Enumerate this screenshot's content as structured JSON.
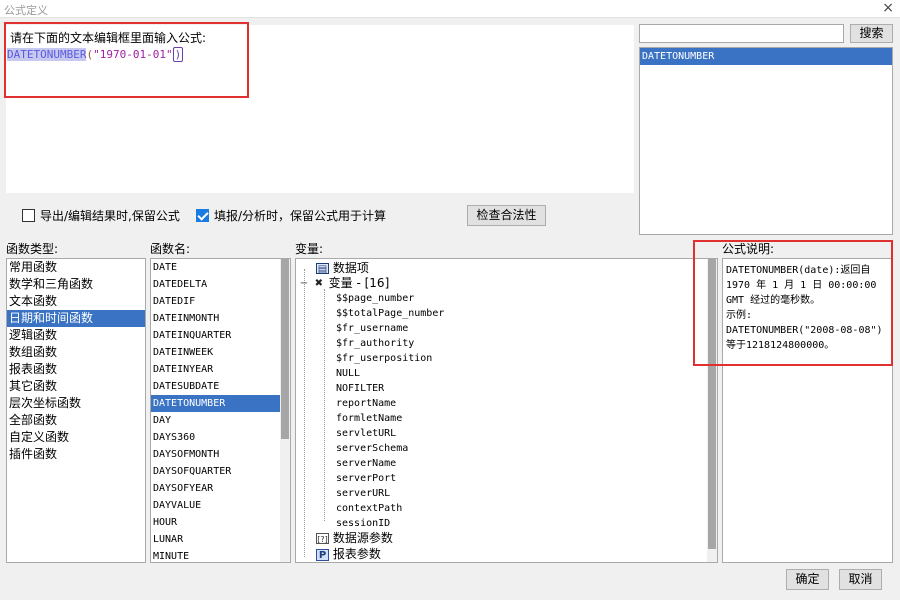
{
  "window": {
    "title": "公式定义",
    "close_glyph": "×"
  },
  "editor": {
    "prompt": "请在下面的文本编辑框里面输入公式:",
    "code_fn": "DATETONUMBER",
    "code_open": "(",
    "code_string": "\"1970-01-01\"",
    "code_close": ")"
  },
  "search": {
    "value": "",
    "button_label": "搜索",
    "results": [
      "DATETONUMBER"
    ]
  },
  "options": {
    "keep_formula_export_label": "导出/编辑结果时,保留公式",
    "keep_formula_export_checked": false,
    "keep_formula_fill_label": "填报/分析时，保留公式用于计算",
    "keep_formula_fill_checked": true,
    "validate_button": "检查合法性"
  },
  "labels": {
    "function_type": "函数类型:",
    "function_name": "函数名:",
    "variables": "变量:",
    "formula_desc": "公式说明:"
  },
  "function_types": [
    "常用函数",
    "数学和三角函数",
    "文本函数",
    "日期和时间函数",
    "逻辑函数",
    "数组函数",
    "报表函数",
    "其它函数",
    "层次坐标函数",
    "全部函数",
    "自定义函数",
    "插件函数"
  ],
  "selected_function_type": "日期和时间函数",
  "function_names": [
    "DATE",
    "DATEDELTA",
    "DATEDIF",
    "DATEINMONTH",
    "DATEINQUARTER",
    "DATEINWEEK",
    "DATEINYEAR",
    "DATESUBDATE",
    "DATETONUMBER",
    "DAY",
    "DAYS360",
    "DAYSOFMONTH",
    "DAYSOFQUARTER",
    "DAYSOFYEAR",
    "DAYVALUE",
    "HOUR",
    "LUNAR",
    "MINUTE"
  ],
  "selected_function_name": "DATETONUMBER",
  "variables": {
    "data_items": "数据项",
    "var_group": "变量 - [16]",
    "var_items": [
      "$$page_number",
      "$$totalPage_number",
      "$fr_username",
      "$fr_authority",
      "$fr_userposition",
      "NULL",
      "NOFILTER",
      "reportName",
      "formletName",
      "servletURL",
      "serverSchema",
      "serverName",
      "serverPort",
      "serverURL",
      "contextPath",
      "sessionID"
    ],
    "datasource_params": "数据源参数",
    "report_params": "报表参数"
  },
  "description": {
    "lines": [
      "DATETONUMBER(date):返回自",
      "1970 年 1 月 1 日 00:00:00",
      "GMT 经过的毫秒数。",
      "示例:",
      "DATETONUMBER(\"2008-08-08\")",
      "等于1218124800000。"
    ]
  },
  "buttons": {
    "ok": "确定",
    "cancel": "取消"
  },
  "colors": {
    "selection": "#3b73c4",
    "highlight_box": "#e03030",
    "checkbox_on": "#1a7be0"
  }
}
